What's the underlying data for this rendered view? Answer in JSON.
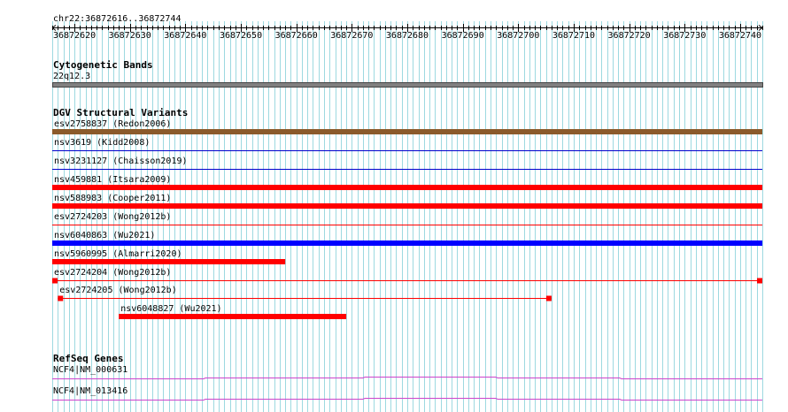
{
  "ruler": {
    "location": "chr22:36872616..36872744",
    "start": 36872616,
    "end": 36872744,
    "ticks": [
      "36872620",
      "36872630",
      "36872640",
      "36872650",
      "36872660",
      "36872670",
      "36872680",
      "36872690",
      "36872700",
      "36872710",
      "36872720",
      "36872730",
      "36872740"
    ]
  },
  "cytobands": {
    "title": "Cytogenetic Bands",
    "band_label": "22q12.3",
    "band_color": "#808080"
  },
  "dgv": {
    "title": "DGV Structural Variants",
    "features": [
      {
        "label": "esv2758837 (Redon2006)",
        "color": "#8B5A2B",
        "style": "thick",
        "start": 36872616,
        "end": 36872744
      },
      {
        "label": "nsv3619 (Kidd2008)",
        "color": "#0000CD",
        "style": "line",
        "start": 36872616,
        "end": 36872744
      },
      {
        "label": "nsv3231127 (Chaisson2019)",
        "color": "#0000CD",
        "style": "line",
        "start": 36872616,
        "end": 36872744
      },
      {
        "label": "nsv459881 (Itsara2009)",
        "color": "#FF0000",
        "style": "thick",
        "start": 36872616,
        "end": 36872744
      },
      {
        "label": "nsv588983 (Cooper2011)",
        "color": "#FF0000",
        "style": "thick",
        "start": 36872616,
        "end": 36872744
      },
      {
        "label": "esv2724203 (Wong2012b)",
        "color": "#FF0000",
        "style": "line",
        "start": 36872616,
        "end": 36872744
      },
      {
        "label": "nsv6040863 (Wu2021)",
        "color": "#0000FF",
        "style": "thick",
        "start": 36872616,
        "end": 36872744
      },
      {
        "label": "nsv5960995 (Almarri2020)",
        "color": "#FF0000",
        "style": "thick",
        "start": 36872616,
        "end": 36872658
      },
      {
        "label": "esv2724204 (Wong2012b)",
        "color": "#FF0000",
        "style": "linked",
        "start": 36872616,
        "end": 36872744
      },
      {
        "label": "esv2724205 (Wong2012b)",
        "color": "#FF0000",
        "style": "linked",
        "start": 36872617,
        "end": 36872706
      },
      {
        "label": "nsv6048827 (Wu2021)",
        "color": "#FF0000",
        "style": "thick",
        "start": 36872628,
        "end": 36872669
      }
    ]
  },
  "refseq": {
    "title": "RefSeq Genes",
    "color": "#CC44CC",
    "genes": [
      {
        "label": "NCF4|NM_000631"
      },
      {
        "label": "NCF4|NM_013416"
      }
    ]
  },
  "colors": {
    "grid": "#9DD9E0",
    "ruler": "#000000"
  }
}
